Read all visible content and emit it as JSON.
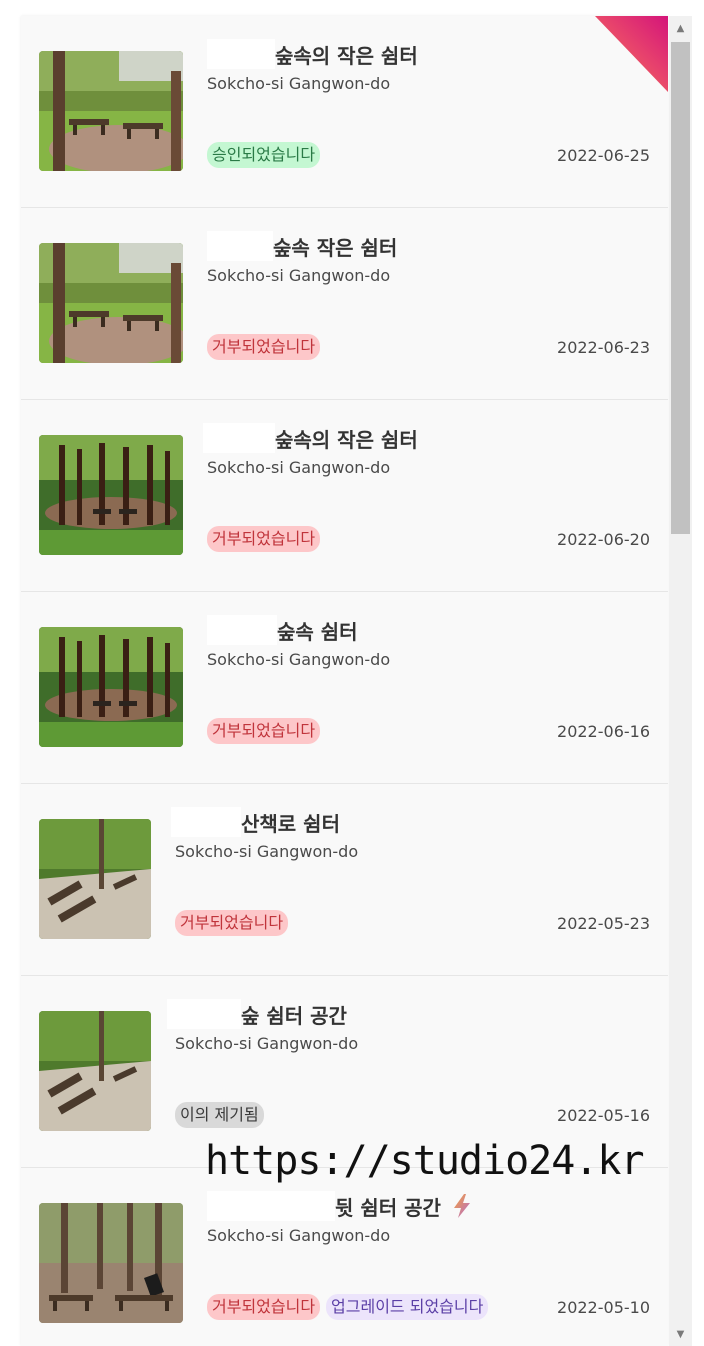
{
  "items": [
    {
      "title": "숲속의 작은 쉼터",
      "location": "Sokcho-si Gangwon-do",
      "badges": [
        "승인되었습니다"
      ],
      "date": "2022-06-25"
    },
    {
      "title": "숲속 작은 쉼터",
      "location": "Sokcho-si Gangwon-do",
      "badges": [
        "거부되었습니다"
      ],
      "date": "2022-06-23"
    },
    {
      "title": "숲속의 작은 쉼터",
      "location": "Sokcho-si Gangwon-do",
      "badges": [
        "거부되었습니다"
      ],
      "date": "2022-06-20"
    },
    {
      "title": "숲속 쉼터",
      "location": "Sokcho-si Gangwon-do",
      "badges": [
        "거부되었습니다"
      ],
      "date": "2022-06-16"
    },
    {
      "title": "산책로 쉼터",
      "location": "Sokcho-si Gangwon-do",
      "badges": [
        "거부되었습니다"
      ],
      "date": "2022-05-23"
    },
    {
      "title": "숲 쉼터 공간",
      "location": "Sokcho-si Gangwon-do",
      "badges": [
        "이의 제기됨"
      ],
      "date": "2022-05-16"
    },
    {
      "title": "뒷 쉼터 공간",
      "location": "Sokcho-si Gangwon-do",
      "badges": [
        "거부되었습니다",
        "업그레이드 되었습니다"
      ],
      "date": "2022-05-10"
    }
  ],
  "watermark": "https://studio24.kr",
  "icons": {
    "upgrade": "lightning-bolt-icon",
    "scroll_up": "arrow-up-icon",
    "scroll_down": "arrow-down-icon"
  },
  "colors": {
    "approved": "#c4f7d2",
    "rejected": "#fdc7c9",
    "disputed": "#d9d9d9",
    "upgraded": "#ece4fb",
    "ribbon": "#e5306a"
  }
}
